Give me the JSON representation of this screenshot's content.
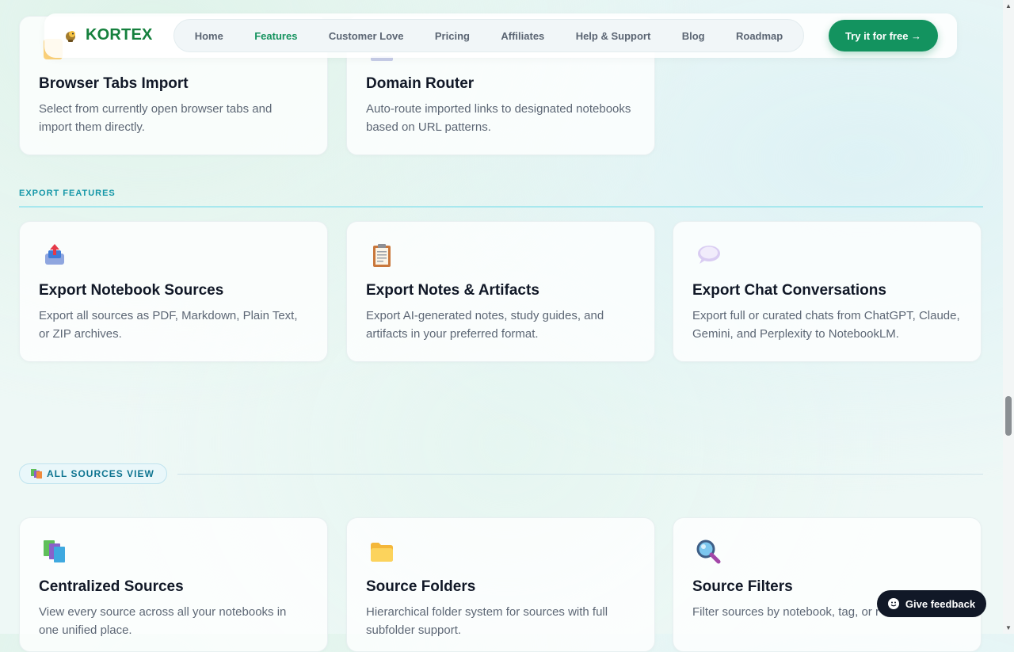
{
  "nav": {
    "brand": "KORTEX",
    "links": [
      "Home",
      "Features",
      "Customer Love",
      "Pricing",
      "Affiliates",
      "Help & Support",
      "Blog",
      "Roadmap"
    ],
    "active": "Features",
    "cta": "Try it for free →"
  },
  "import_cards": [
    {
      "title": "Browser Tabs Import",
      "desc": "Select from currently open browser tabs and import them directly."
    },
    {
      "title": "Domain Router",
      "desc": "Auto-route imported links to designated notebooks based on URL patterns."
    }
  ],
  "export_section": {
    "label": "EXPORT FEATURES",
    "cards": [
      {
        "title": "Export Notebook Sources",
        "desc": "Export all sources as PDF, Markdown, Plain Text, or ZIP archives.",
        "icon": "outbox-tray-icon"
      },
      {
        "title": "Export Notes & Artifacts",
        "desc": "Export AI-generated notes, study guides, and artifacts in your preferred format.",
        "icon": "clipboard-icon"
      },
      {
        "title": "Export Chat Conversations",
        "desc": "Export full or curated chats from ChatGPT, Claude, Gemini, and Perplexity to NotebookLM.",
        "icon": "speech-bubble-icon"
      }
    ]
  },
  "sources_section": {
    "label": "ALL SOURCES VIEW",
    "cards": [
      {
        "title": "Centralized Sources",
        "desc": "View every source across all your notebooks in one unified place.",
        "icon": "books-icon"
      },
      {
        "title": "Source Folders",
        "desc": "Hierarchical folder system for sources with full subfolder support.",
        "icon": "folder-icon"
      },
      {
        "title": "Source Filters",
        "desc": "Filter sources by notebook, tag, or r",
        "icon": "magnifier-icon"
      }
    ]
  },
  "feedback": {
    "label": "Give feedback"
  },
  "colors": {
    "brand": "#15803d",
    "cta": "#13935f",
    "section_accent": "#1597a8"
  }
}
